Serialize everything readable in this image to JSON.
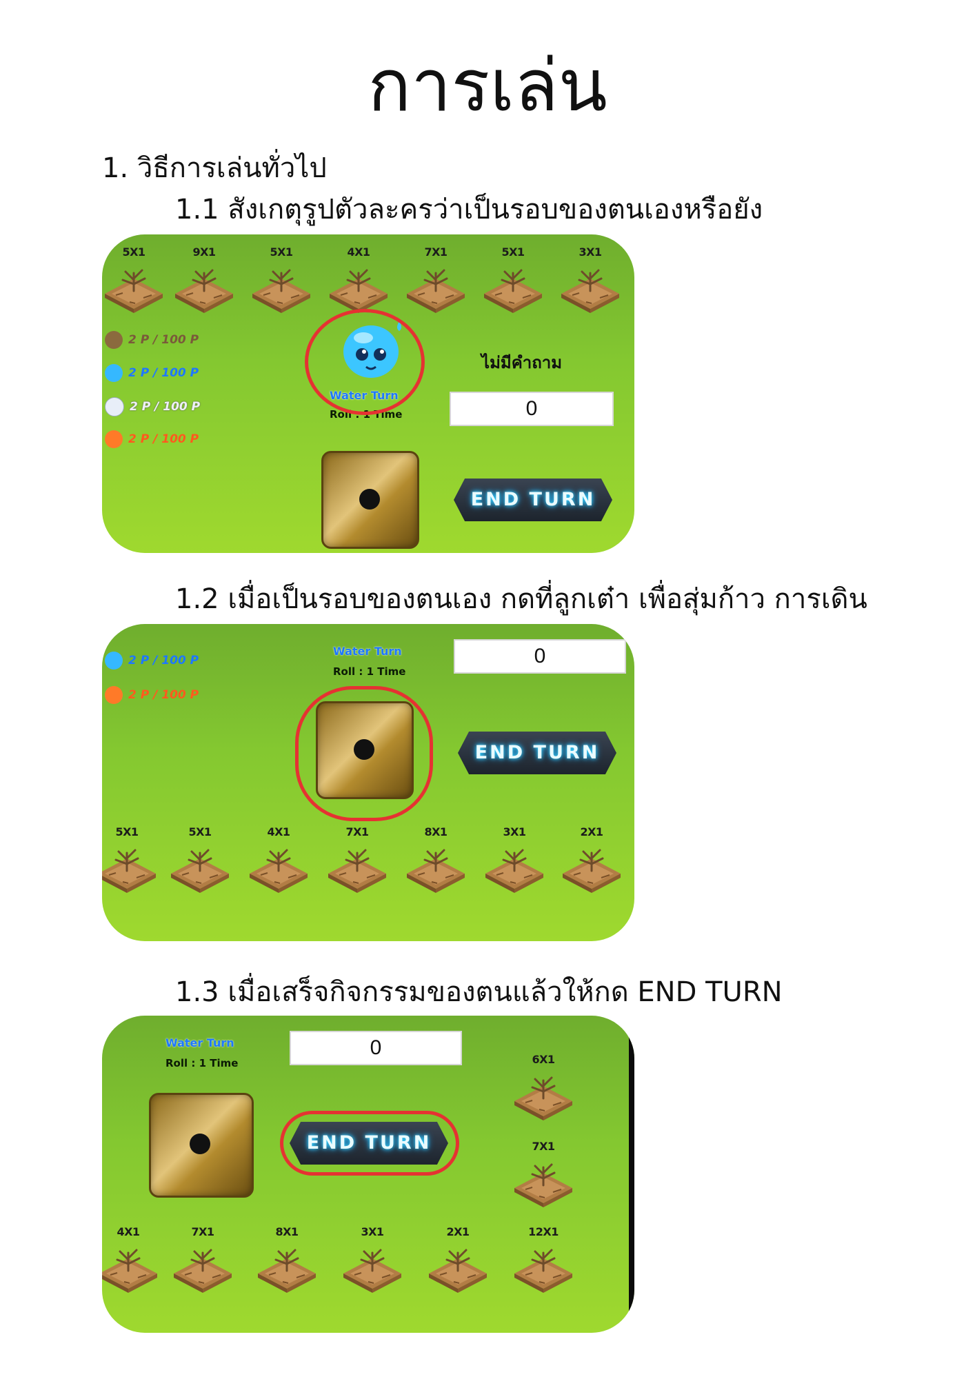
{
  "doc": {
    "title": "การเล่น",
    "h1": "1. วิธีการเล่นทั่วไป",
    "h11": "1.1 สังเกตุรูปตัวละครว่าเป็นรอบของตนเองหรือยัง",
    "h12": "1.2 เมื่อเป็นรอบของตนเอง กดที่ลูกเต๋า เพื่อสุ่มก้าว การเดิน",
    "h13": "1.3 เมื่อเสร็จกิจกรรมของตนแล้วให้กด END TURN"
  },
  "game": {
    "turn_label": "Water Turn",
    "roll_label": "Roll : 1 Time",
    "question_text": "ไม่มีคำถาม",
    "answer_value": "0",
    "end_turn_label": "END TURN",
    "score_text": "2 P / 100 P"
  },
  "shot1": {
    "tiles": [
      "5X1",
      "9X1",
      "5X1",
      "4X1",
      "7X1",
      "5X1",
      "3X1"
    ]
  },
  "shot2": {
    "tiles": [
      "5X1",
      "5X1",
      "4X1",
      "7X1",
      "8X1",
      "3X1",
      "2X1"
    ]
  },
  "shot3": {
    "side_tiles": [
      "6X1",
      "7X1"
    ],
    "tiles": [
      "4X1",
      "7X1",
      "8X1",
      "3X1",
      "2X1",
      "12X1"
    ]
  },
  "colors": {
    "highlight_ring": "#e53232",
    "water_player": "#1e78ff",
    "earth_player": "#7a5a3a",
    "air_player": "#e8e8f0",
    "fire_player": "#ff5a1e"
  }
}
